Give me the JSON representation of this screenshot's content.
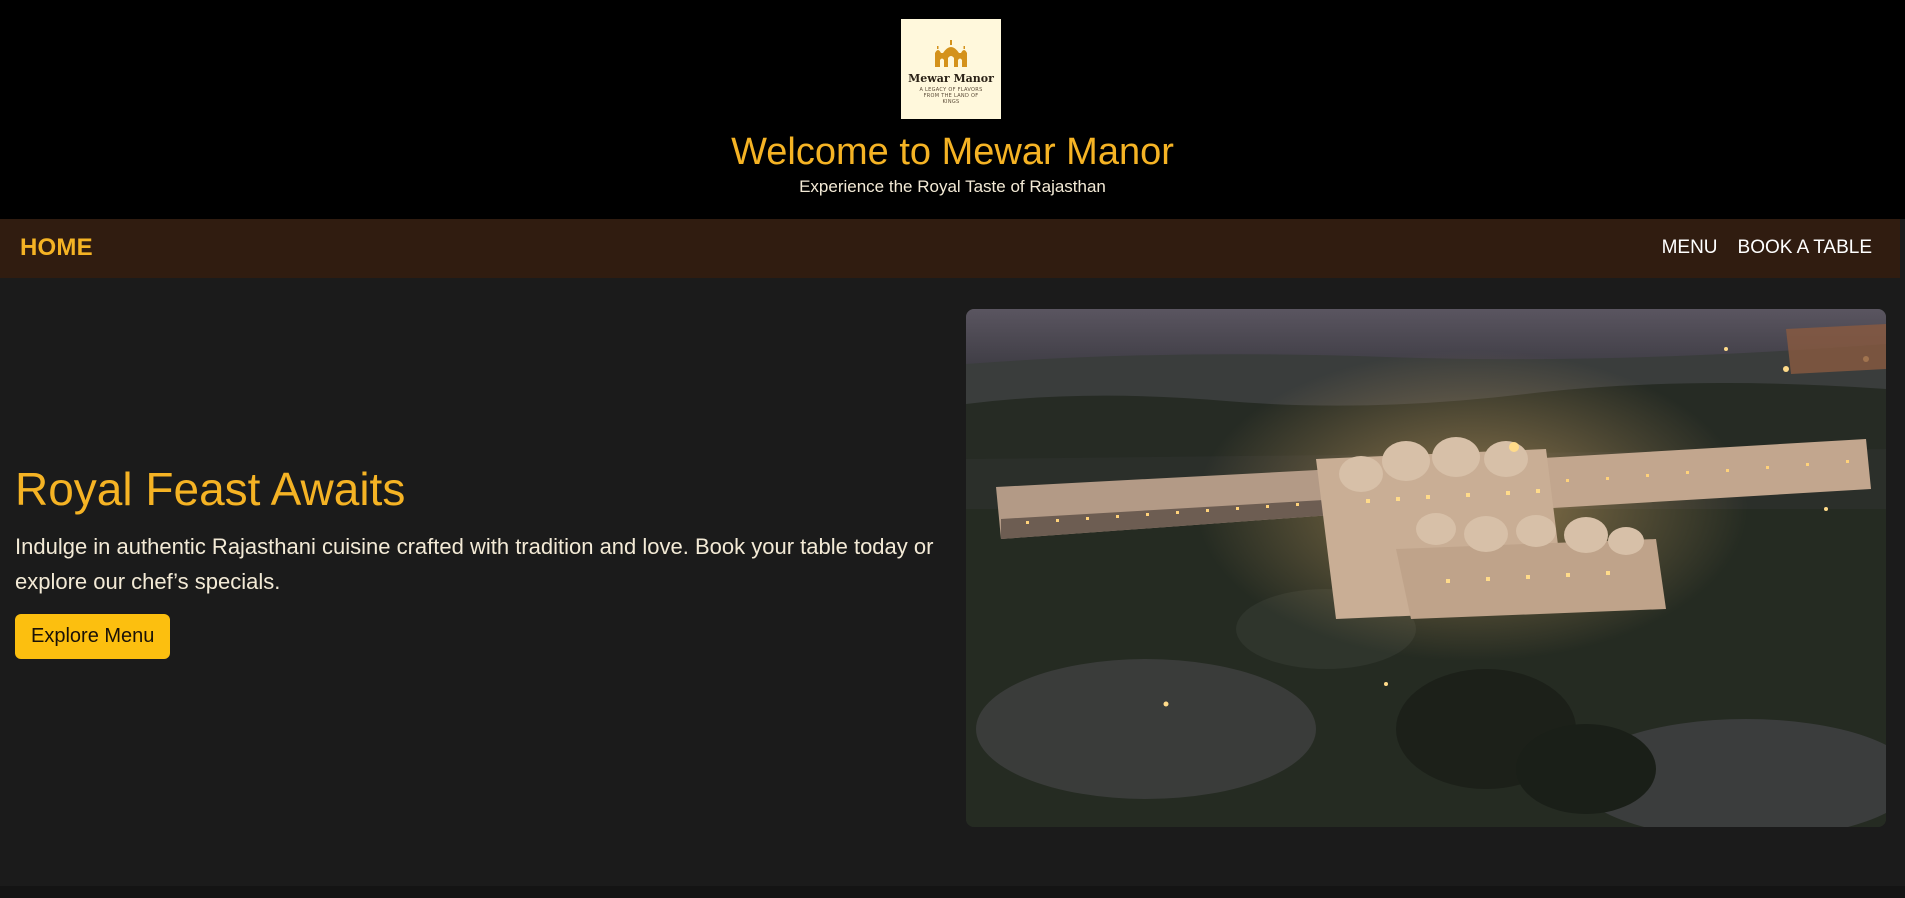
{
  "header": {
    "logo": {
      "name": "Mewar Manor",
      "tagline": "A LEGACY OF FLAVORS FROM THE LAND OF KINGS",
      "icon": "palace-icon"
    },
    "title": "Welcome to Mewar Manor",
    "subtitle": "Experience the Royal Taste of Rajasthan"
  },
  "nav": {
    "brand": "HOME",
    "links": [
      {
        "label": "MENU"
      },
      {
        "label": "BOOK A TABLE"
      }
    ]
  },
  "hero": {
    "title": "Royal Feast Awaits",
    "description": "Indulge in authentic Rajasthani cuisine crafted with tradition and love. Book your table today or explore our chef’s specials.",
    "button_label": "Explore Menu",
    "image": "aerial-palace-night-photo"
  },
  "colors": {
    "accent": "#f5b324",
    "button": "#fcbf0f",
    "header_bg": "#000000",
    "nav_bg": "#301c10",
    "page_bg": "#1b1b1b",
    "text_light": "#f3ead6"
  }
}
